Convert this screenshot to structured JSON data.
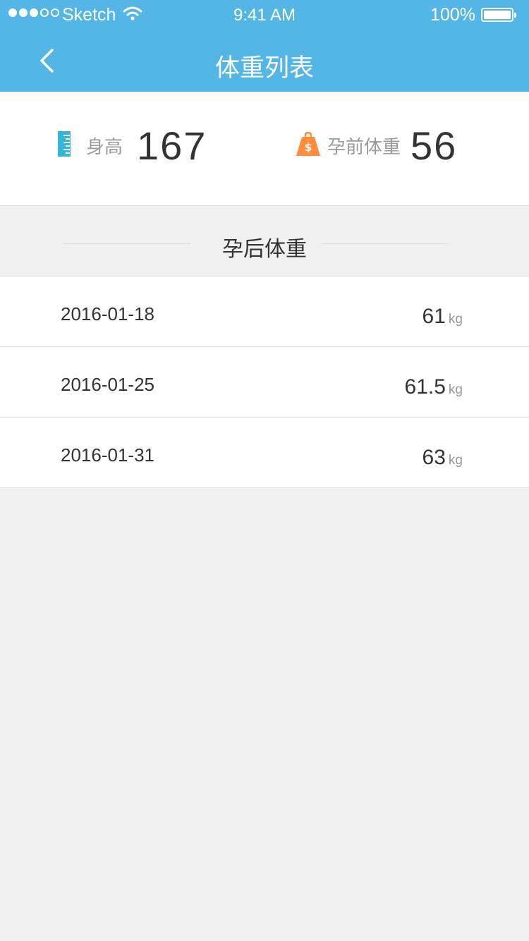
{
  "status_bar": {
    "carrier": "Sketch",
    "time": "9:41 AM",
    "battery": "100%"
  },
  "nav": {
    "title": "体重列表",
    "back_icon": "chevron-left-icon"
  },
  "summary": {
    "height": {
      "icon": "ruler-icon",
      "label": "身高",
      "value": "167"
    },
    "pre_pregnancy_weight": {
      "icon": "weight-bag-icon",
      "label": "孕前体重",
      "value": "56"
    }
  },
  "section": {
    "title": "孕后体重"
  },
  "records": [
    {
      "date": "2016-01-18",
      "weight": "61",
      "unit": "kg"
    },
    {
      "date": "2016-01-25",
      "weight": "61.5",
      "unit": "kg"
    },
    {
      "date": "2016-01-31",
      "weight": "63",
      "unit": "kg"
    }
  ],
  "colors": {
    "header": "#53b6e7",
    "ruler": "#33b6d8",
    "weight_icon": "#ff8d3f",
    "background": "#f0f0f0"
  }
}
